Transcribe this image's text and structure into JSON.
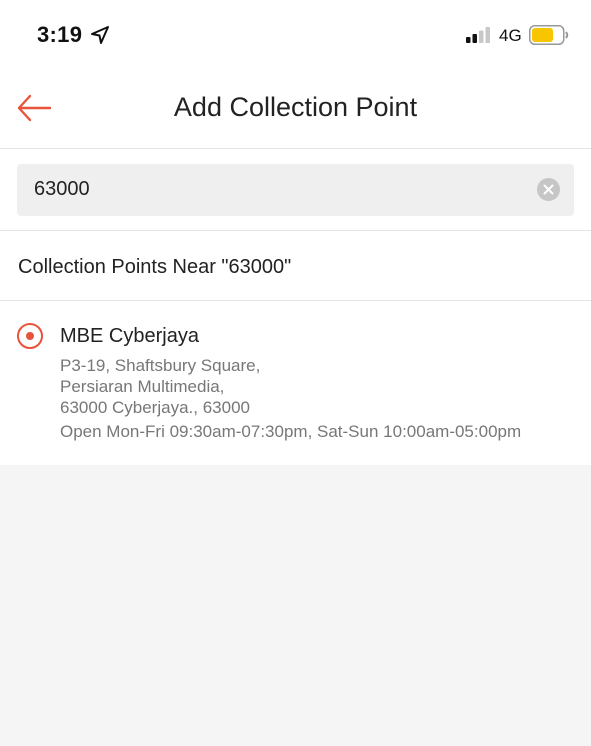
{
  "status_bar": {
    "time": "3:19",
    "network": "4G",
    "battery_color": "#f7c600"
  },
  "nav": {
    "title": "Add Collection Point",
    "accent_color": "#e8543b"
  },
  "search": {
    "value": "63000",
    "placeholder": ""
  },
  "results": {
    "header": "Collection Points Near \"63000\"",
    "items": [
      {
        "name": "MBE Cyberjaya",
        "address_lines": [
          "P3-19, Shaftsbury Square,",
          "Persiaran Multimedia,",
          "63000 Cyberjaya., 63000"
        ],
        "hours": "Open Mon-Fri 09:30am-07:30pm, Sat-Sun 10:00am-05:00pm",
        "selected": true
      }
    ]
  }
}
